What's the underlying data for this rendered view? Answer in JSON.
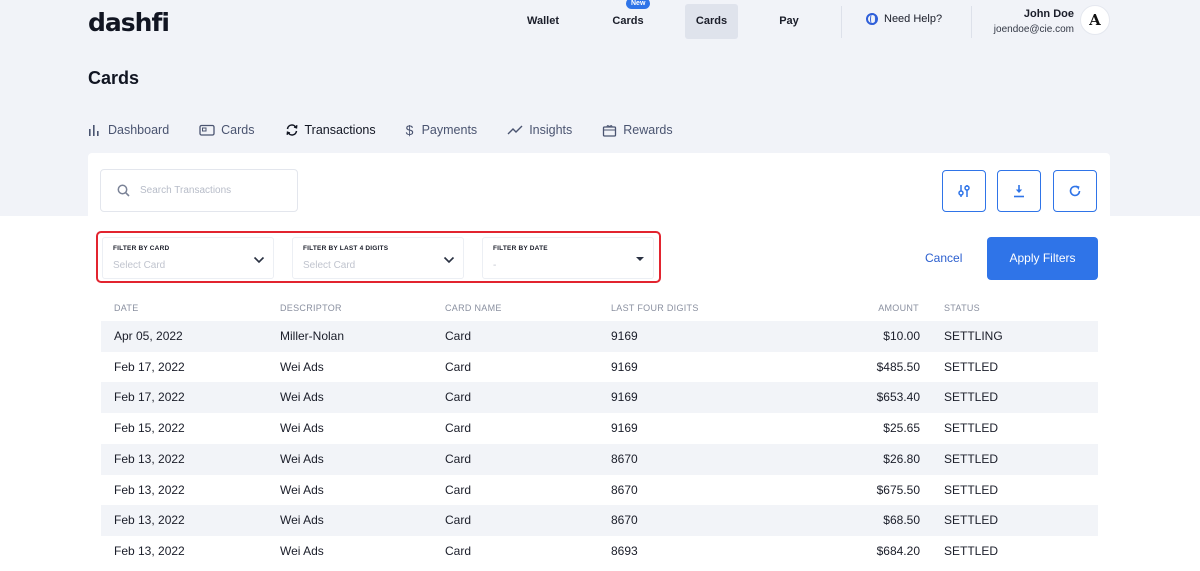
{
  "brand": {
    "logo": "dashfi"
  },
  "topnav": {
    "wallet": "Wallet",
    "cards_new": "Cards",
    "new_badge": "New",
    "cards": "Cards",
    "pay": "Pay",
    "help": "Need Help?"
  },
  "user": {
    "name": "John Doe",
    "email": "joendoe@cie.com",
    "avatar_letter": "A"
  },
  "page": {
    "title": "Cards"
  },
  "subnav": {
    "dashboard": "Dashboard",
    "cards": "Cards",
    "transactions": "Transactions",
    "payments": "Payments",
    "insights": "Insights",
    "rewards": "Rewards"
  },
  "search": {
    "placeholder": "Search Transactions"
  },
  "filters": {
    "card": {
      "label": "FILTER BY CARD",
      "value": "Select Card"
    },
    "last4": {
      "label": "FILTER BY LAST 4 DIGITS",
      "value": "Select Card"
    },
    "date": {
      "label": "FILTER BY DATE",
      "value": "-"
    },
    "cancel": "Cancel",
    "apply": "Apply Filters"
  },
  "table": {
    "headers": {
      "date": "DATE",
      "descriptor": "DESCRIPTOR",
      "card_name": "CARD NAME",
      "last_four": "LAST FOUR DIGITS",
      "amount": "AMOUNT",
      "status": "STATUS"
    },
    "rows": [
      {
        "date": "Apr 05, 2022",
        "descriptor": "Miller-Nolan",
        "card_name": "Card",
        "last_four": "9169",
        "amount": "$10.00",
        "status": "SETTLING"
      },
      {
        "date": "Feb 17, 2022",
        "descriptor": "Wei Ads",
        "card_name": "Card",
        "last_four": "9169",
        "amount": "$485.50",
        "status": "SETTLED"
      },
      {
        "date": "Feb 17, 2022",
        "descriptor": "Wei Ads",
        "card_name": "Card",
        "last_four": "9169",
        "amount": "$653.40",
        "status": "SETTLED"
      },
      {
        "date": "Feb 15, 2022",
        "descriptor": "Wei Ads",
        "card_name": "Card",
        "last_four": "9169",
        "amount": "$25.65",
        "status": "SETTLED"
      },
      {
        "date": "Feb 13, 2022",
        "descriptor": "Wei Ads",
        "card_name": "Card",
        "last_four": "8670",
        "amount": "$26.80",
        "status": "SETTLED"
      },
      {
        "date": "Feb 13, 2022",
        "descriptor": "Wei Ads",
        "card_name": "Card",
        "last_four": "8670",
        "amount": "$675.50",
        "status": "SETTLED"
      },
      {
        "date": "Feb 13, 2022",
        "descriptor": "Wei Ads",
        "card_name": "Card",
        "last_four": "8670",
        "amount": "$68.50",
        "status": "SETTLED"
      },
      {
        "date": "Feb 13, 2022",
        "descriptor": "Wei Ads",
        "card_name": "Card",
        "last_four": "8693",
        "amount": "$684.20",
        "status": "SETTLED"
      }
    ]
  },
  "colors": {
    "accent": "#2f74e8",
    "highlight_outline": "#e2242f",
    "background": "#f1f3f8"
  },
  "icons": {
    "search": "search-icon",
    "filter_settings": "sliders-icon",
    "download": "download-icon",
    "refresh": "refresh-icon",
    "help": "globe-icon"
  }
}
